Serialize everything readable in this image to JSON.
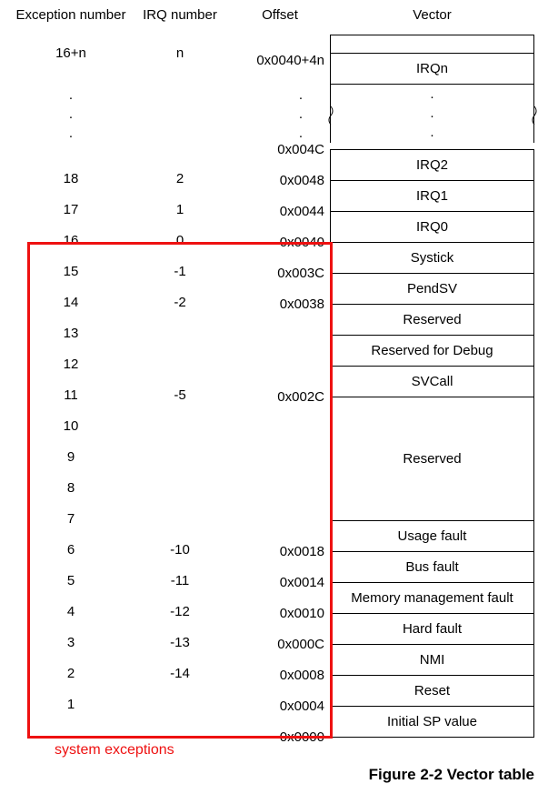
{
  "headers": {
    "exception": "Exception number",
    "irq": "IRQ number",
    "offset": "Offset",
    "vector": "Vector"
  },
  "top": {
    "exception": "16+n",
    "irq": "n",
    "offset": "0x0040+4n",
    "vector": "IRQn"
  },
  "dots": {
    "d1": ".",
    "d2": ".",
    "d3": "."
  },
  "ex_nums": {
    "e18": "18",
    "e17": "17",
    "e16": "16",
    "e15": "15",
    "e14": "14",
    "e13": "13",
    "e12": "12",
    "e11": "11",
    "e10": "10",
    "e9": "9",
    "e8": "8",
    "e7": "7",
    "e6": "6",
    "e5": "5",
    "e4": "4",
    "e3": "3",
    "e2": "2",
    "e1": "1"
  },
  "irq_nums": {
    "i18": "2",
    "i17": "1",
    "i16": "0",
    "i15": "-1",
    "i14": "-2",
    "i13": "",
    "i12": "",
    "i11": "-5",
    "i10": "",
    "i9": "",
    "i8": "",
    "i7": "",
    "i6": "-10",
    "i5": "-11",
    "i4": "-12",
    "i3": "-13",
    "i2": "-14",
    "i1": ""
  },
  "offsets": {
    "o004C": "0x004C",
    "o0048": "0x0048",
    "o0044": "0x0044",
    "o0040": "0x0040",
    "o003C": "0x003C",
    "o0038": "0x0038",
    "o002C": "0x002C",
    "o0018": "0x0018",
    "o0014": "0x0014",
    "o0010": "0x0010",
    "o000C": "0x000C",
    "o0008": "0x0008",
    "o0004": "0x0004",
    "o0000": "0x0000"
  },
  "vectors": {
    "irq2": "IRQ2",
    "irq1": "IRQ1",
    "irq0": "IRQ0",
    "systick": "Systick",
    "pendsv": "PendSV",
    "res1": "Reserved",
    "resdbg": "Reserved for Debug",
    "svcall": "SVCall",
    "res4": "Reserved",
    "usage": "Usage fault",
    "bus": "Bus fault",
    "mem": "Memory management fault",
    "hard": "Hard fault",
    "nmi": "NMI",
    "reset": "Reset",
    "initsp": "Initial SP value"
  },
  "labels": {
    "system_exceptions": "system exceptions",
    "figure": "Figure 2-2 Vector table"
  },
  "chart_data": {
    "type": "table",
    "title": "Figure 2-2 Vector table",
    "columns": [
      "Exception number",
      "IRQ number",
      "Offset",
      "Vector"
    ],
    "rows": [
      {
        "exception": "16+n",
        "irq": "n",
        "offset": "0x0040+4n",
        "vector": "IRQn",
        "system_exception": false
      },
      {
        "exception": "18",
        "irq": "2",
        "offset": "0x0048",
        "vector": "IRQ2",
        "system_exception": false
      },
      {
        "exception": "17",
        "irq": "1",
        "offset": "0x0044",
        "vector": "IRQ1",
        "system_exception": false
      },
      {
        "exception": "16",
        "irq": "0",
        "offset": "0x0040",
        "vector": "IRQ0",
        "system_exception": false
      },
      {
        "exception": "15",
        "irq": "-1",
        "offset": "0x003C",
        "vector": "Systick",
        "system_exception": true
      },
      {
        "exception": "14",
        "irq": "-2",
        "offset": "0x0038",
        "vector": "PendSV",
        "system_exception": true
      },
      {
        "exception": "13",
        "irq": "",
        "offset": "",
        "vector": "Reserved",
        "system_exception": true
      },
      {
        "exception": "12",
        "irq": "",
        "offset": "",
        "vector": "Reserved for Debug",
        "system_exception": true
      },
      {
        "exception": "11",
        "irq": "-5",
        "offset": "0x002C",
        "vector": "SVCall",
        "system_exception": true
      },
      {
        "exception": "10",
        "irq": "",
        "offset": "",
        "vector": "Reserved",
        "system_exception": true
      },
      {
        "exception": "9",
        "irq": "",
        "offset": "",
        "vector": "Reserved",
        "system_exception": true
      },
      {
        "exception": "8",
        "irq": "",
        "offset": "",
        "vector": "Reserved",
        "system_exception": true
      },
      {
        "exception": "7",
        "irq": "",
        "offset": "",
        "vector": "Reserved",
        "system_exception": true
      },
      {
        "exception": "6",
        "irq": "-10",
        "offset": "0x0018",
        "vector": "Usage fault",
        "system_exception": true
      },
      {
        "exception": "5",
        "irq": "-11",
        "offset": "0x0014",
        "vector": "Bus fault",
        "system_exception": true
      },
      {
        "exception": "4",
        "irq": "-12",
        "offset": "0x0010",
        "vector": "Memory management fault",
        "system_exception": true
      },
      {
        "exception": "3",
        "irq": "-13",
        "offset": "0x000C",
        "vector": "Hard fault",
        "system_exception": true
      },
      {
        "exception": "2",
        "irq": "-14",
        "offset": "0x0008",
        "vector": "NMI",
        "system_exception": true
      },
      {
        "exception": "1",
        "irq": "",
        "offset": "0x0004",
        "vector": "Reset",
        "system_exception": true
      },
      {
        "exception": "",
        "irq": "",
        "offset": "0x0000",
        "vector": "Initial SP value",
        "system_exception": true
      }
    ]
  }
}
